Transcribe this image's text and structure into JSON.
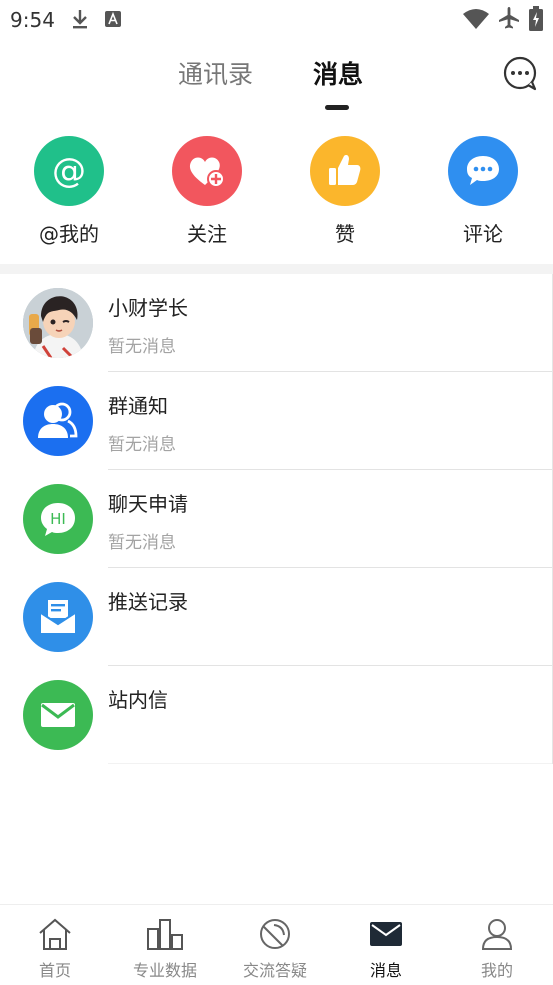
{
  "status_bar": {
    "time": "9:54"
  },
  "header": {
    "tabs": [
      {
        "label": "通讯录",
        "active": false
      },
      {
        "label": "消息",
        "active": true
      }
    ]
  },
  "quick_actions": [
    {
      "label": "@我的",
      "color": "#20C08A",
      "icon": "at-icon"
    },
    {
      "label": "关注",
      "color": "#F2565E",
      "icon": "heart-plus-icon"
    },
    {
      "label": "赞",
      "color": "#FBB62C",
      "icon": "thumbs-up-icon"
    },
    {
      "label": "评论",
      "color": "#2F8FF0",
      "icon": "comment-icon"
    }
  ],
  "messages": [
    {
      "title": "小财学长",
      "subtitle": "暂无消息",
      "avatar": "cartoon-avatar"
    },
    {
      "title": "群通知",
      "subtitle": "暂无消息",
      "avatar": "group-icon",
      "color": "#1B6FF0"
    },
    {
      "title": "聊天申请",
      "subtitle": "暂无消息",
      "avatar": "hi-bubble-icon",
      "color": "#3CBA54"
    },
    {
      "title": "推送记录",
      "subtitle": "",
      "avatar": "inbox-icon",
      "color": "#2F8FE8"
    },
    {
      "title": "站内信",
      "subtitle": "",
      "avatar": "mail-icon",
      "color": "#3CBA54"
    }
  ],
  "bottom_nav": [
    {
      "label": "首页",
      "icon": "home-icon",
      "active": false
    },
    {
      "label": "专业数据",
      "icon": "bar-chart-icon",
      "active": false
    },
    {
      "label": "交流答疑",
      "icon": "satellite-icon",
      "active": false
    },
    {
      "label": "消息",
      "icon": "envelope-icon",
      "active": true
    },
    {
      "label": "我的",
      "icon": "user-icon",
      "active": false
    }
  ]
}
